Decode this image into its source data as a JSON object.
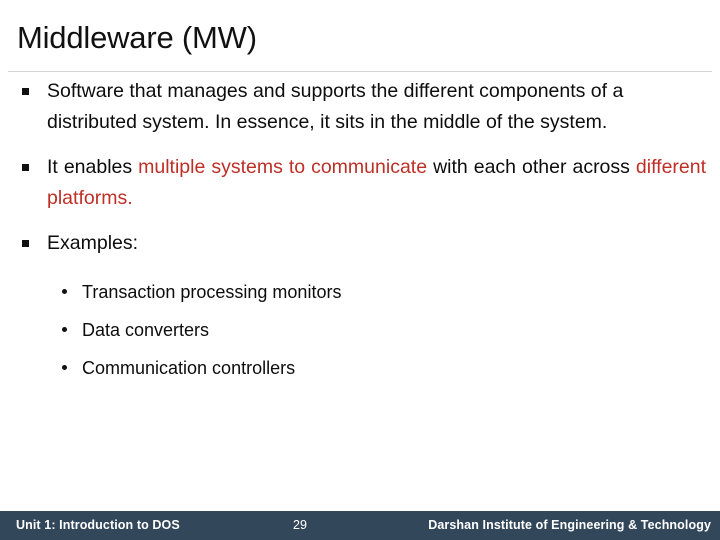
{
  "slide": {
    "title": "Middleware (MW)",
    "accent_red": "#be2f26",
    "footer_bar_color": "#33475b",
    "text_color": "#0d0d0d"
  },
  "bullets": {
    "b1": {
      "line1": "Software that manages and supports the different components of",
      "line2": "a distributed system. In essence, it sits in the middle of the system."
    },
    "b2": {
      "pre": "It enables",
      "red1": "multiple systems to communicate",
      "mid": "with each other",
      "post": "across",
      "red2": "different platforms."
    },
    "b3": {
      "label": "Examples:"
    },
    "sub": [
      {
        "label": "Transaction processing monitors"
      },
      {
        "label": "Data converters"
      },
      {
        "label": "Communication controllers"
      }
    ]
  },
  "footer": {
    "unit": "Unit 1: Introduction to DOS",
    "page_number": "29",
    "institute": "Darshan Institute of Engineering & Technology"
  }
}
